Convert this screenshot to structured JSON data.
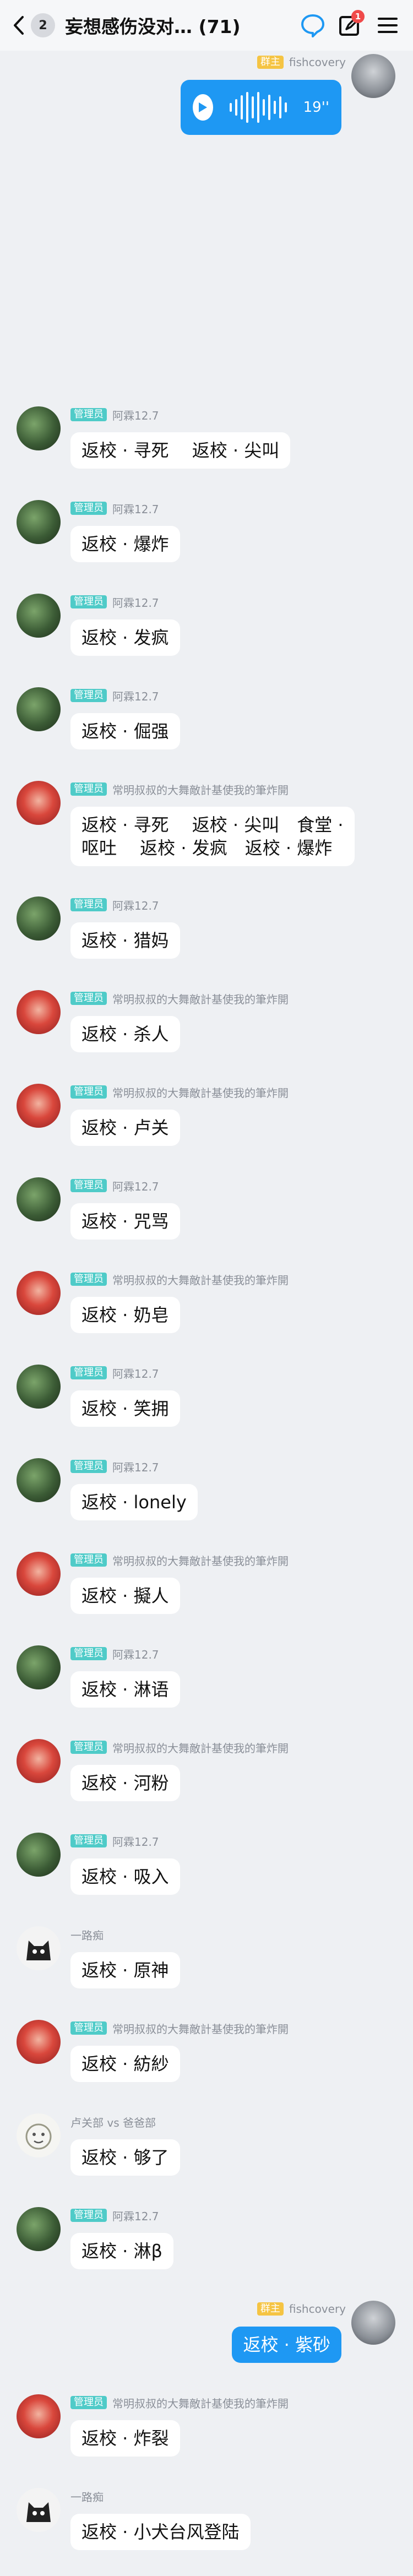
{
  "header": {
    "unread_count": "2",
    "title": "妄想感伤没对… (71)",
    "notification_count": "1"
  },
  "messages": [
    {
      "id": "m0",
      "role": "群主",
      "sender": "fishcovery",
      "type": "voice",
      "duration": "19''",
      "self": true
    },
    {
      "id": "m1",
      "role": "管理员",
      "sender": "阿霖12.7",
      "text": "返校 · 寻死　 返校 · 尖叫"
    },
    {
      "id": "m2",
      "role": "管理员",
      "sender": "阿霖12.7",
      "text": "返校 · 爆炸"
    },
    {
      "id": "m3",
      "role": "管理员",
      "sender": "阿霖12.7",
      "text": "返校 · 发疯"
    },
    {
      "id": "m4",
      "role": "管理员",
      "sender": "阿霖12.7",
      "text": "返校 · 倔强"
    },
    {
      "id": "m5",
      "role": "管理员",
      "sender": "常明叔叔的大舞敵計基使我的筆炸開",
      "line1": "返校 · 寻死　 返校 · 尖叫　食堂 ·",
      "line2": "呕吐　 返校 · 发疯　返校 · 爆炸"
    },
    {
      "id": "m6",
      "role": "管理员",
      "sender": "阿霖12.7",
      "text": "返校 · 猎妈"
    },
    {
      "id": "m7",
      "role": "管理员",
      "sender": "常明叔叔的大舞敵計基使我的筆炸開",
      "text": "返校 · 杀人"
    },
    {
      "id": "m8",
      "role": "管理员",
      "sender": "常明叔叔的大舞敵計基使我的筆炸開",
      "text": "返校 · 卢关"
    },
    {
      "id": "m9",
      "role": "管理员",
      "sender": "阿霖12.7",
      "text": "返校 · 咒骂"
    },
    {
      "id": "m10",
      "role": "管理员",
      "sender": "常明叔叔的大舞敵計基使我的筆炸開",
      "text": "返校 · 奶皂"
    },
    {
      "id": "m11",
      "role": "管理员",
      "sender": "阿霖12.7",
      "text": "返校 · 笑拥"
    },
    {
      "id": "m12",
      "role": "管理员",
      "sender": "阿霖12.7",
      "text": "返校 · lonely"
    },
    {
      "id": "m13",
      "role": "管理员",
      "sender": "常明叔叔的大舞敵計基使我的筆炸開",
      "text": "返校 · 擬人"
    },
    {
      "id": "m14",
      "role": "管理员",
      "sender": "阿霖12.7",
      "text": "返校 · 淋语"
    },
    {
      "id": "m15",
      "role": "管理员",
      "sender": "常明叔叔的大舞敵計基使我的筆炸開",
      "text": "返校 · 河粉"
    },
    {
      "id": "m16",
      "role": "管理员",
      "sender": "阿霖12.7",
      "text": "返校 · 吸入"
    },
    {
      "id": "m17",
      "role": "",
      "sender": "一路痴",
      "text": "返校 · 原神"
    },
    {
      "id": "m18",
      "role": "管理员",
      "sender": "常明叔叔的大舞敵計基使我的筆炸開",
      "text": "返校 · 紡紗"
    },
    {
      "id": "m19",
      "role": "",
      "sender": "卢关部 vs 爸爸部",
      "text": "返校 · 够了"
    },
    {
      "id": "m20",
      "role": "管理员",
      "sender": "阿霖12.7",
      "text": "返校 · 淋β"
    },
    {
      "id": "m21",
      "role": "群主",
      "sender": "fishcovery",
      "text": "返校 · 紫砂",
      "self": true
    },
    {
      "id": "m22",
      "role": "管理员",
      "sender": "常明叔叔的大舞敵計基使我的筆炸開",
      "text": "返校 · 炸裂"
    },
    {
      "id": "m23",
      "role": "",
      "sender": "一路痴",
      "text": "返校 · 小犬台风登陆"
    }
  ],
  "colors": {
    "accent": "#1e98f3",
    "admin_badge": "#4fcbc8",
    "owner_badge": "#f5c443",
    "background": "#eef0f3"
  },
  "icons": [
    "back-icon",
    "chat-bubble-icon",
    "compose-icon",
    "menu-icon",
    "play-icon"
  ]
}
